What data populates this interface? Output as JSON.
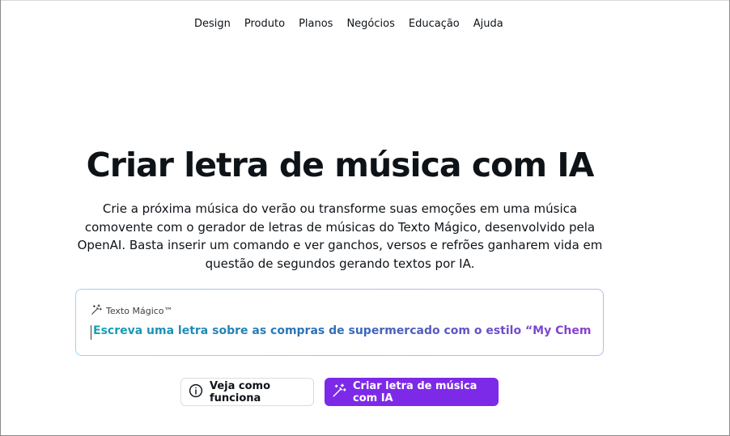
{
  "nav": {
    "items": [
      "Design",
      "Produto",
      "Planos",
      "Negócios",
      "Educação",
      "Ajuda"
    ]
  },
  "hero": {
    "title": "Criar letra de música com IA",
    "description": "Crie a próxima música do verão ou transforme suas emoções em uma música comovente com o gerador de letras de músicas do Texto Mágico, desenvolvido pela OpenAI. Basta inserir um comando e ver ganchos, versos e refrões ganharem vida em questão de segundos gerando textos por IA."
  },
  "magic_input": {
    "label": "Texto Mágico™",
    "icon": "magic-wand-icon",
    "prompt": "Escreva uma letra sobre as compras de supermercado com o estilo “My Chemical Roman..."
  },
  "buttons": {
    "secondary_label": "Veja como funciona",
    "secondary_icon": "info-icon",
    "primary_label": "Criar letra de música com IA",
    "primary_icon": "magic-wand-icon"
  },
  "colors": {
    "primary": "#7d2ae8",
    "text": "#0e1318",
    "gradient_start": "#16a0b4",
    "gradient_end": "#8b3fd0"
  }
}
